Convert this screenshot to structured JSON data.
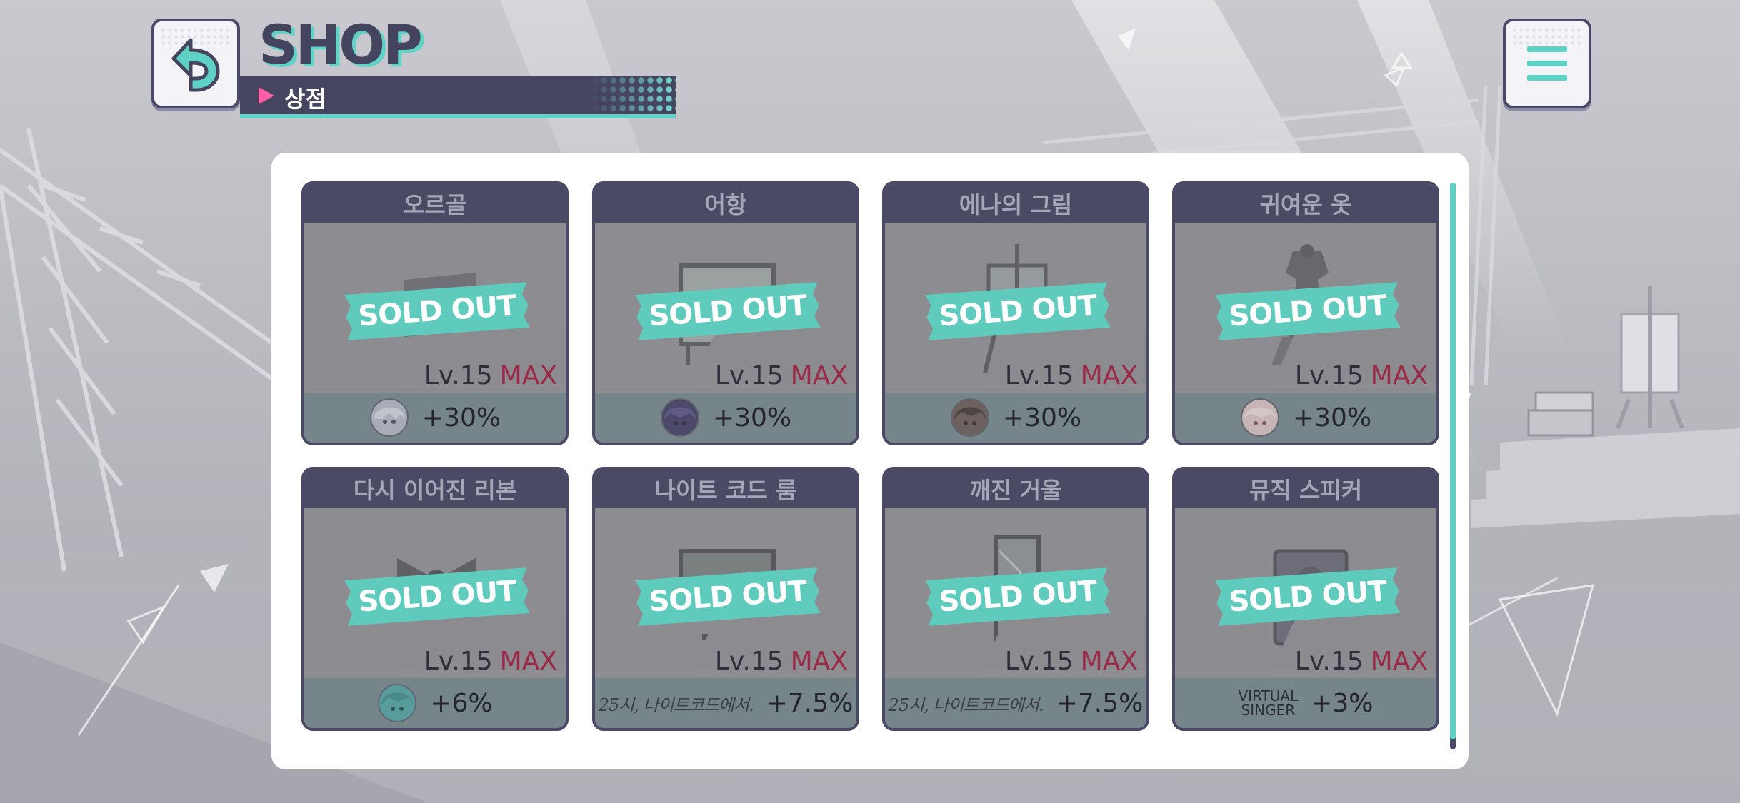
{
  "header": {
    "title": "SHOP",
    "subtitle": "상점"
  },
  "colors": {
    "accent": "#60d3c6",
    "navy": "#45455f",
    "max_red": "#9b2946",
    "pink_arrow": "#ff5fa6"
  },
  "icons": {
    "back": "back-arrow-icon",
    "menu": "hamburger-menu-icon"
  },
  "items": [
    {
      "name": "오르골",
      "item_icon": "music-box-icon",
      "sold_out": "SOLD OUT",
      "level": "Lv.15",
      "max": "MAX",
      "bonus_icon": "character-icon",
      "bonus": "+30%"
    },
    {
      "name": "어항",
      "item_icon": "fish-tank-icon",
      "sold_out": "SOLD OUT",
      "level": "Lv.15",
      "max": "MAX",
      "bonus_icon": "character-icon",
      "bonus": "+30%"
    },
    {
      "name": "에나의 그림",
      "item_icon": "easel-painting-icon",
      "sold_out": "SOLD OUT",
      "level": "Lv.15",
      "max": "MAX",
      "bonus_icon": "character-icon",
      "bonus": "+30%"
    },
    {
      "name": "귀여운 옷",
      "item_icon": "cute-clothes-icon",
      "sold_out": "SOLD OUT",
      "level": "Lv.15",
      "max": "MAX",
      "bonus_icon": "character-icon",
      "bonus": "+30%"
    },
    {
      "name": "다시 이어진 리본",
      "item_icon": "ribbon-icon",
      "sold_out": "SOLD OUT",
      "level": "Lv.15",
      "max": "MAX",
      "bonus_icon": "character-icon",
      "bonus": "+6%"
    },
    {
      "name": "나이트 코드 룸",
      "item_icon": "monitor-icon",
      "sold_out": "SOLD OUT",
      "level": "Lv.15",
      "max": "MAX",
      "bonus_icon": "unit-logo-icon",
      "bonus_logo": "25시, 나이트코드에서.",
      "bonus": "+7.5%"
    },
    {
      "name": "깨진 거울",
      "item_icon": "broken-mirror-icon",
      "sold_out": "SOLD OUT",
      "level": "Lv.15",
      "max": "MAX",
      "bonus_icon": "unit-logo-icon",
      "bonus_logo": "25시, 나이트코드에서.",
      "bonus": "+7.5%"
    },
    {
      "name": "뮤직 스피커",
      "item_icon": "speaker-icon",
      "sold_out": "SOLD OUT",
      "level": "Lv.15",
      "max": "MAX",
      "bonus_icon": "virtual-singer-logo-icon",
      "bonus_logo_line1": "VIRTUAL",
      "bonus_logo_line2": "SINGER",
      "bonus": "+3%"
    }
  ]
}
